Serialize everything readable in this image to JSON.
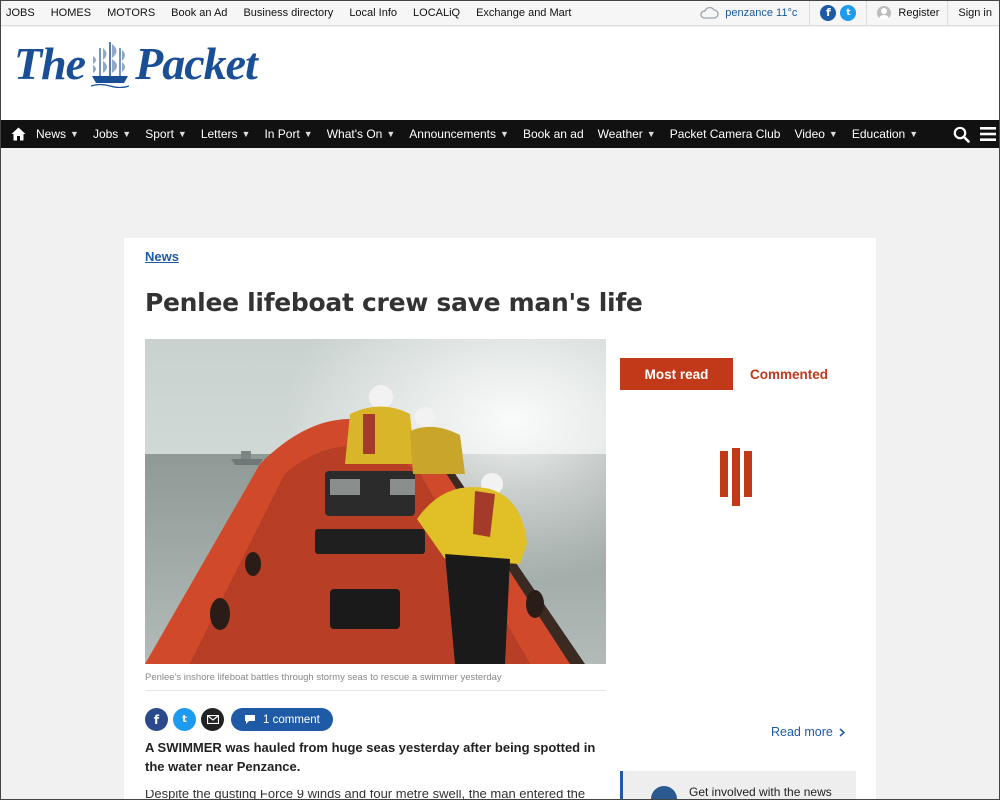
{
  "topbar": {
    "links": [
      "JOBS",
      "HOMES",
      "MOTORS",
      "Book an Ad",
      "Business directory",
      "Local Info",
      "LOCALiQ",
      "Exchange and Mart"
    ],
    "weather": "penzance 11°c",
    "register": "Register",
    "sign_in": "Sign in"
  },
  "brand": {
    "word1": "The",
    "word2": "Packet",
    "color": "#1a4f96"
  },
  "nav": {
    "items": [
      {
        "label": "News",
        "dropdown": true
      },
      {
        "label": "Jobs",
        "dropdown": true
      },
      {
        "label": "Sport",
        "dropdown": true
      },
      {
        "label": "Letters",
        "dropdown": true
      },
      {
        "label": "In Port",
        "dropdown": true
      },
      {
        "label": "What's On",
        "dropdown": true
      },
      {
        "label": "Announcements",
        "dropdown": true
      },
      {
        "label": "Book an ad",
        "dropdown": false
      },
      {
        "label": "Weather",
        "dropdown": true
      },
      {
        "label": "Packet Camera Club",
        "dropdown": false
      },
      {
        "label": "Video",
        "dropdown": true
      },
      {
        "label": "Education",
        "dropdown": true
      }
    ]
  },
  "article": {
    "category": "News",
    "headline": "Penlee lifeboat crew save man's life",
    "caption": "Penlee's inshore lifeboat battles through stormy seas to rescue a swimmer yesterday",
    "comment_label": "1 comment",
    "lede": "A SWIMMER was hauled from huge seas yesterday after being spotted in the water near Penzance.",
    "body_start": "Despite the gusting Force 9 winds and four metre swell, the man entered the"
  },
  "sidebar": {
    "tab_most_read": "Most read",
    "tab_commented": "Commented",
    "read_more": "Read more",
    "get_involved": "Get involved with the news"
  },
  "colors": {
    "accent_red": "#c2391a",
    "link_blue": "#1f5aa6",
    "nav_bg": "#111111"
  }
}
